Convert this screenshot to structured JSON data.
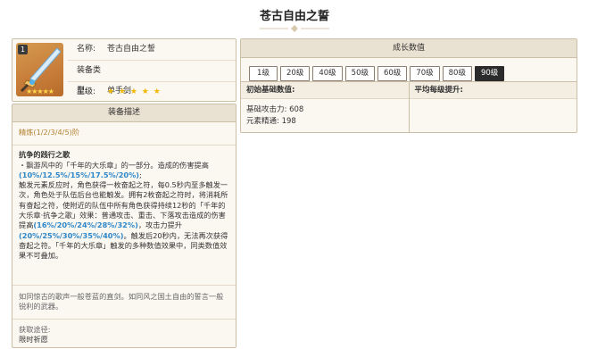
{
  "page_title": "苍古自由之誓",
  "info": {
    "rarity_badge": "1",
    "icon_stars": "★★★★★",
    "name_label": "名称:",
    "name_value": "苍古自由之誓",
    "type_label": "装备类型:",
    "type_value": "单手剑",
    "star_label": "星级:",
    "star_value": "★ ★ ★ ★ ★"
  },
  "desc": {
    "header": "装备描述",
    "refine": "精炼(1/2/3/4/5)阶",
    "passive_title": "抗争的践行之歌",
    "p1": "・飘游风中的「千年的大乐章」的一部分。造成的伤害提高",
    "p1_hl": "(10%/12.5%/15%/17.5%/20%)",
    "p1_end": ";",
    "p2a": "触发元素反应时，角色获得一枚奋起之符，每0.5秒内至多触发一次，角色处于队伍后台也能触发。拥有2枚奋起之符时，将消耗所有奋起之符，使附近的队伍中所有角色获得持续12秒的「千年的大乐章·抗争之歌」效果：普通攻击、重击、下落攻击造成的伤害提高",
    "p2_hl1": "(16%/20%/24%/28%/32%)",
    "p2b": "，攻击力提升",
    "p2_hl2": "(20%/25%/30%/35%/40%)",
    "p2c": "。触发后20秒内，无法再次获得奋起之符。「千年的大乐章」触发的多种数值效果中，同类数值效果不可叠加。",
    "flavor": "如同惊古的歌声一般苍蓝的直剑。如同风之国土自由的誓言一般锐利的武器。",
    "source_label": "获取途径:",
    "source_value": "限时祈愿"
  },
  "stats": {
    "header": "成长数值",
    "levels": [
      "1级",
      "20级",
      "40级",
      "50级",
      "60级",
      "70级",
      "80级",
      "90级"
    ],
    "active_level": "90级",
    "base_header": "初始基础数值:",
    "growth_header": "平均每级提升:",
    "base_atk": "基础攻击力: 608",
    "base_em": "元素精通: 198"
  }
}
